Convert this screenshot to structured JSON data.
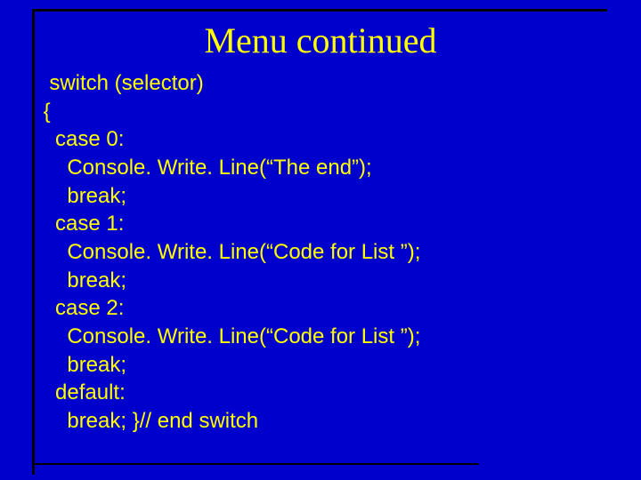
{
  "title": "Menu continued",
  "code": {
    "l01": "  switch (selector)",
    "l02": " {",
    "l03": "   case 0:",
    "l04": "     Console. Write. Line(“The end”);",
    "l05": "     break;",
    "l06": "   case 1:",
    "l07": "     Console. Write. Line(“Code for List ”);",
    "l08": "     break;",
    "l09": "   case 2:",
    "l10": "     Console. Write. Line(“Code for List ”);",
    "l11": "     break;",
    "l12": "   default:",
    "l13": "     break; }// end switch"
  }
}
